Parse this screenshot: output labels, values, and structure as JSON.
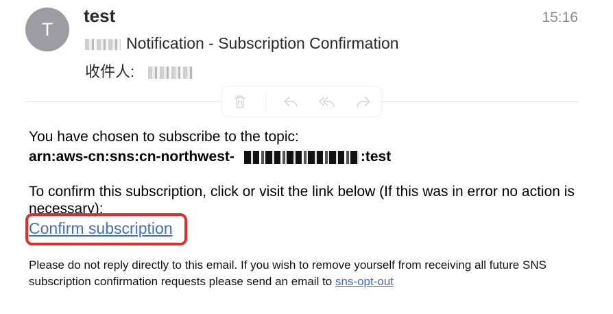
{
  "message": {
    "avatar_initial": "T",
    "sender": "test",
    "time": "15:16",
    "subject": "Notification - Subscription Confirmation",
    "recipient_label": "收件人:"
  },
  "toolbar": {
    "icons": [
      "trash-icon",
      "reply-icon",
      "reply-all-icon",
      "forward-icon"
    ],
    "icon_color": "#d8d8d8"
  },
  "content": {
    "intro": "You have chosen to subscribe to the topic:",
    "arn_prefix": "arn:aws-cn:sns:cn-northwest-",
    "arn_suffix": ":test",
    "instruction": "To confirm this subscription, click or visit the link below (If this was in error no action is necessary):",
    "confirm_link": "Confirm subscription",
    "footer": "Please do not reply directly to this email. If you wish to remove yourself from receiving all future SNS subscription confirmation requests please send an email to ",
    "opt_out_link": "sns-opt-out"
  },
  "colors": {
    "link": "#3d6fc2",
    "highlight": "#df2d2a",
    "avatar": "#9c9ca2"
  }
}
